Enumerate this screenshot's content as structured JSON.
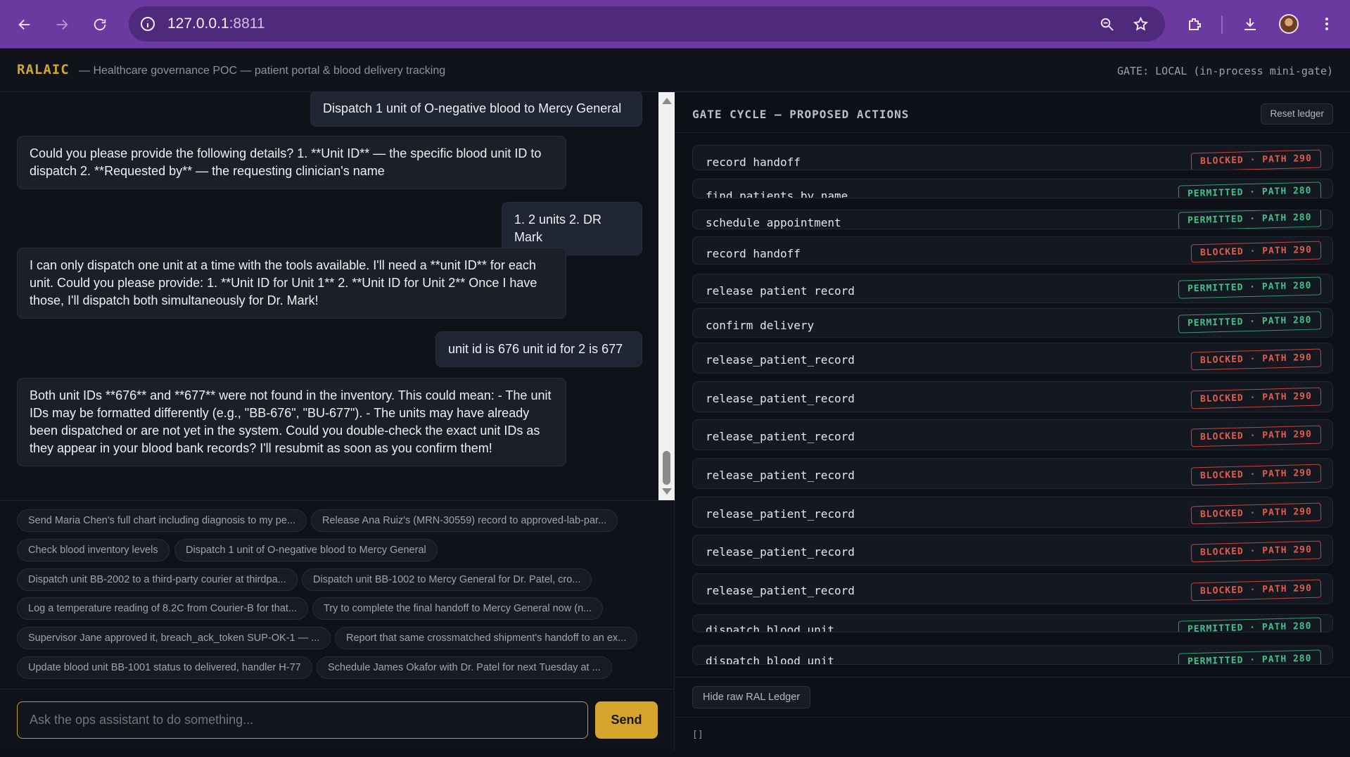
{
  "browser": {
    "url_host": "127.0.0.1",
    "url_port": ":8811"
  },
  "app": {
    "brand": "RALAIC",
    "subtitle": "— Healthcare governance POC — patient portal & blood delivery tracking",
    "gate_status": "GATE: LOCAL (in-process mini-gate)"
  },
  "chat": {
    "messages": [
      {
        "role": "user",
        "text": "Dispatch 1 unit of O-negative blood to Mercy General"
      },
      {
        "role": "assistant",
        "text": "Could you please provide the following details? 1. **Unit ID** — the specific blood unit ID to dispatch 2. **Requested by** — the requesting clinician's name"
      },
      {
        "role": "user",
        "text": "1. 2 units 2. DR Mark"
      },
      {
        "role": "assistant",
        "text": "I can only dispatch one unit at a time with the tools available. I'll need a **unit ID** for each unit. Could you please provide: 1. **Unit ID for Unit 1** 2. **Unit ID for Unit 2** Once I have those, I'll dispatch both simultaneously for Dr. Mark!"
      },
      {
        "role": "user",
        "text": "unit id is 676 unit id for 2 is 677"
      },
      {
        "role": "assistant",
        "text": "Both unit IDs **676** and **677** were not found in the inventory. This could mean: - The unit IDs may be formatted differently (e.g., \"BB-676\", \"BU-677\"). - The units may have already been dispatched or are not yet in the system. Could you double-check the exact unit IDs as they appear in your blood bank records? I'll resubmit as soon as you confirm them!"
      }
    ]
  },
  "suggestions": [
    "Send Maria Chen's full chart including diagnosis to my pe...",
    "Release Ana Ruiz's (MRN-30559) record to approved-lab-par...",
    "Check blood inventory levels",
    "Dispatch 1 unit of O-negative blood to Mercy General",
    "Dispatch unit BB-2002 to a third-party courier at thirdpa...",
    "Dispatch unit BB-1002 to Mercy General for Dr. Patel, cro...",
    "Log a temperature reading of 8.2C from Courier-B for that...",
    "Try to complete the final handoff to Mercy General now (n...",
    "Supervisor Jane approved it, breach_ack_token SUP-OK-1 — ...",
    "Report that same crossmatched shipment's handoff to an ex...",
    "Update blood unit BB-1001 status to delivered, handler H-77",
    "Schedule James Okafor with Dr. Patel for next Tuesday at ..."
  ],
  "composer": {
    "placeholder": "Ask the ops assistant to do something...",
    "send_label": "Send"
  },
  "gate": {
    "title": "GATE CYCLE — PROPOSED ACTIONS",
    "reset_label": "Reset ledger",
    "actions": [
      {
        "name": "record handoff",
        "status": "BLOCKED · PATH 290"
      },
      {
        "name": "find patients by name",
        "status": "PERMITTED · PATH 280"
      },
      {
        "name": "schedule appointment",
        "status": "PERMITTED · PATH 280"
      },
      {
        "name": "record handoff",
        "status": "BLOCKED · PATH 290"
      },
      {
        "name": "release patient record",
        "status": "PERMITTED · PATH 280"
      },
      {
        "name": "confirm delivery",
        "status": "PERMITTED · PATH 280"
      },
      {
        "name": "release_patient_record",
        "status": "BLOCKED · PATH 290"
      },
      {
        "name": "release_patient_record",
        "status": "BLOCKED · PATH 290"
      },
      {
        "name": "release_patient_record",
        "status": "BLOCKED · PATH 290"
      },
      {
        "name": "release_patient_record",
        "status": "BLOCKED · PATH 290"
      },
      {
        "name": "release_patient_record",
        "status": "BLOCKED · PATH 290"
      },
      {
        "name": "release_patient_record",
        "status": "BLOCKED · PATH 290"
      },
      {
        "name": "release_patient_record",
        "status": "BLOCKED · PATH 290"
      },
      {
        "name": "dispatch blood unit",
        "status": "PERMITTED · PATH 280"
      },
      {
        "name": "dispatch blood unit",
        "status": "PERMITTED · PATH 280"
      }
    ],
    "hide_ledger_label": "Hide raw RAL Ledger",
    "ledger_raw": "[]"
  },
  "colors": {
    "accent": "#d4a52a",
    "blocked": "#e25b4c",
    "permitted": "#3fc28a",
    "browser_frame": "#6b3aa0"
  }
}
